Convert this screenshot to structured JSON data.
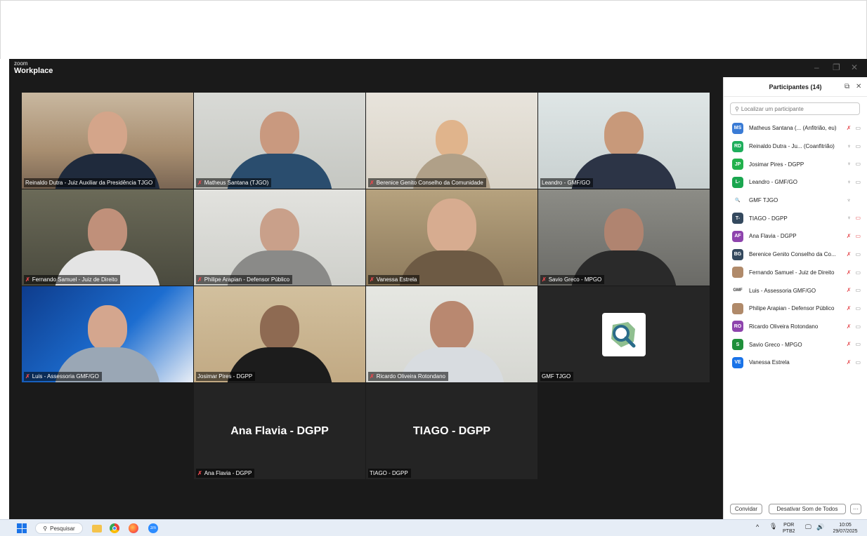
{
  "window": {
    "brand_small": "zoom",
    "brand_big": "Workplace",
    "controls": [
      "–",
      "❐",
      "✕"
    ]
  },
  "tiles": [
    {
      "name": "Reinaldo Dutra - Juiz Auxiliar da Presidência TJGO",
      "muted": false
    },
    {
      "name": "Matheus Santana (TJGO)",
      "muted": true
    },
    {
      "name": "Berenice Genito Conselho da Comunidade",
      "muted": true
    },
    {
      "name": "Leandro - GMF/GO",
      "muted": false,
      "active": true
    },
    {
      "name": "Fernando Samuel - Juiz de Direito",
      "muted": true
    },
    {
      "name": "Philipe Arapian - Defensor Público",
      "muted": true
    },
    {
      "name": "Vanessa Estrela",
      "muted": true
    },
    {
      "name": "Savio Greco - MPGO",
      "muted": true
    },
    {
      "name": "Luis - Assessoria GMF/GO",
      "muted": true
    },
    {
      "name": "Josimar Pires - DGPP",
      "muted": false
    },
    {
      "name": "Ricardo Oliveira Rotondano",
      "muted": true
    },
    {
      "name": "GMF TJGO",
      "muted": false
    },
    {
      "name": "Ana Flavia - DGPP",
      "muted": true,
      "display": "Ana Flavia - DGPP"
    },
    {
      "name": "TIAGO - DGPP",
      "muted": false,
      "display": "TIAGO - DGPP"
    }
  ],
  "panel": {
    "title": "Participantes (14)",
    "search_placeholder": "Localizar um participante",
    "participants": [
      {
        "initials": "MS",
        "color": "#3a7bd5",
        "name": "Matheus Santana (... (Anfitrião, eu)",
        "mic": "off",
        "cam": "on"
      },
      {
        "initials": "RD",
        "color": "#1fae5c",
        "name": "Reinaldo Dutra - Ju... (Coanfitrião)",
        "mic": "on",
        "cam": "on"
      },
      {
        "initials": "JP",
        "color": "#22b14c",
        "name": "Josimar Pires - DGPP",
        "mic": "on",
        "cam": "on"
      },
      {
        "initials": "L-",
        "color": "#1aa64f",
        "name": "Leandro - GMF/GO",
        "mic": "on",
        "cam": "on"
      },
      {
        "initials": "",
        "color": "logo",
        "name": "GMF TJGO",
        "mic": "on",
        "cam": "none"
      },
      {
        "initials": "T-",
        "color": "#34495e",
        "name": "TIAGO - DGPP",
        "mic": "on",
        "cam": "off"
      },
      {
        "initials": "AF",
        "color": "#8e44ad",
        "name": "Ana Flavia - DGPP",
        "mic": "off",
        "cam": "off"
      },
      {
        "initials": "BG",
        "color": "#34495e",
        "name": "Berenice Genito Conselho da Co...",
        "mic": "off",
        "cam": "on"
      },
      {
        "initials": "",
        "color": "photo",
        "name": "Fernando Samuel - Juiz de Direito",
        "mic": "off",
        "cam": "on"
      },
      {
        "initials": "GMF",
        "color": "logo",
        "name": "Luis - Assessoria GMF/GO",
        "mic": "off",
        "cam": "on"
      },
      {
        "initials": "",
        "color": "photo",
        "name": "Philipe Arapian - Defensor Público",
        "mic": "off",
        "cam": "on"
      },
      {
        "initials": "RO",
        "color": "#8e44ad",
        "name": "Ricardo Oliveira Rotondano",
        "mic": "off",
        "cam": "on"
      },
      {
        "initials": "S",
        "color": "#1f8f3a",
        "name": "Savio Greco - MPGO",
        "mic": "off",
        "cam": "on"
      },
      {
        "initials": "VE",
        "color": "#1a73e8",
        "name": "Vanessa Estrela",
        "mic": "off",
        "cam": "on"
      }
    ],
    "invite_label": "Convidar",
    "mute_all_label": "Desativar Som de Todos",
    "more_label": "···"
  },
  "taskbar": {
    "search_label": "Pesquisar",
    "lang_top": "POR",
    "lang_bottom": "PTB2",
    "time": "10:05",
    "date": "29/07/2025"
  }
}
